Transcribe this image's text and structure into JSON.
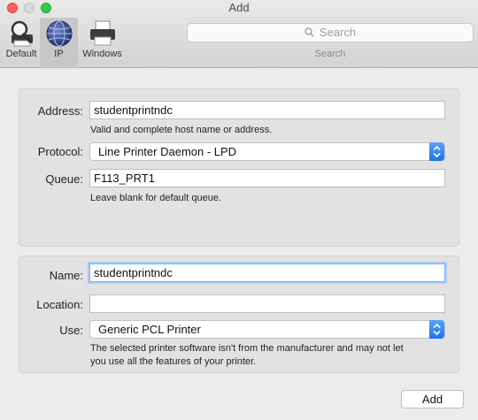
{
  "window": {
    "title": "Add"
  },
  "toolbar": {
    "items": [
      {
        "label": "Default",
        "icon": "magnifier-printer-icon"
      },
      {
        "label": "IP",
        "icon": "globe-icon"
      },
      {
        "label": "Windows",
        "icon": "printer-icon"
      }
    ],
    "selected": "IP",
    "search": {
      "placeholder": "Search",
      "caption": "Search"
    }
  },
  "ip_panel": {
    "address": {
      "label": "Address:",
      "value": "studentprintndc",
      "hint": "Valid and complete host name or address."
    },
    "protocol": {
      "label": "Protocol:",
      "value": "Line Printer Daemon - LPD"
    },
    "queue": {
      "label": "Queue:",
      "value": "F113_PRT1",
      "hint": "Leave blank for default queue."
    }
  },
  "printer_panel": {
    "name": {
      "label": "Name:",
      "value": "studentprintndc"
    },
    "location": {
      "label": "Location:",
      "value": ""
    },
    "use": {
      "label": "Use:",
      "value": "Generic PCL Printer",
      "hint_line1": "The selected printer software isn't from the manufacturer and may not let",
      "hint_line2": "you use all the features of your printer."
    }
  },
  "footer": {
    "add_label": "Add"
  },
  "colors": {
    "accent": "#1a72ec",
    "focus_ring": "#a9cdf5"
  }
}
